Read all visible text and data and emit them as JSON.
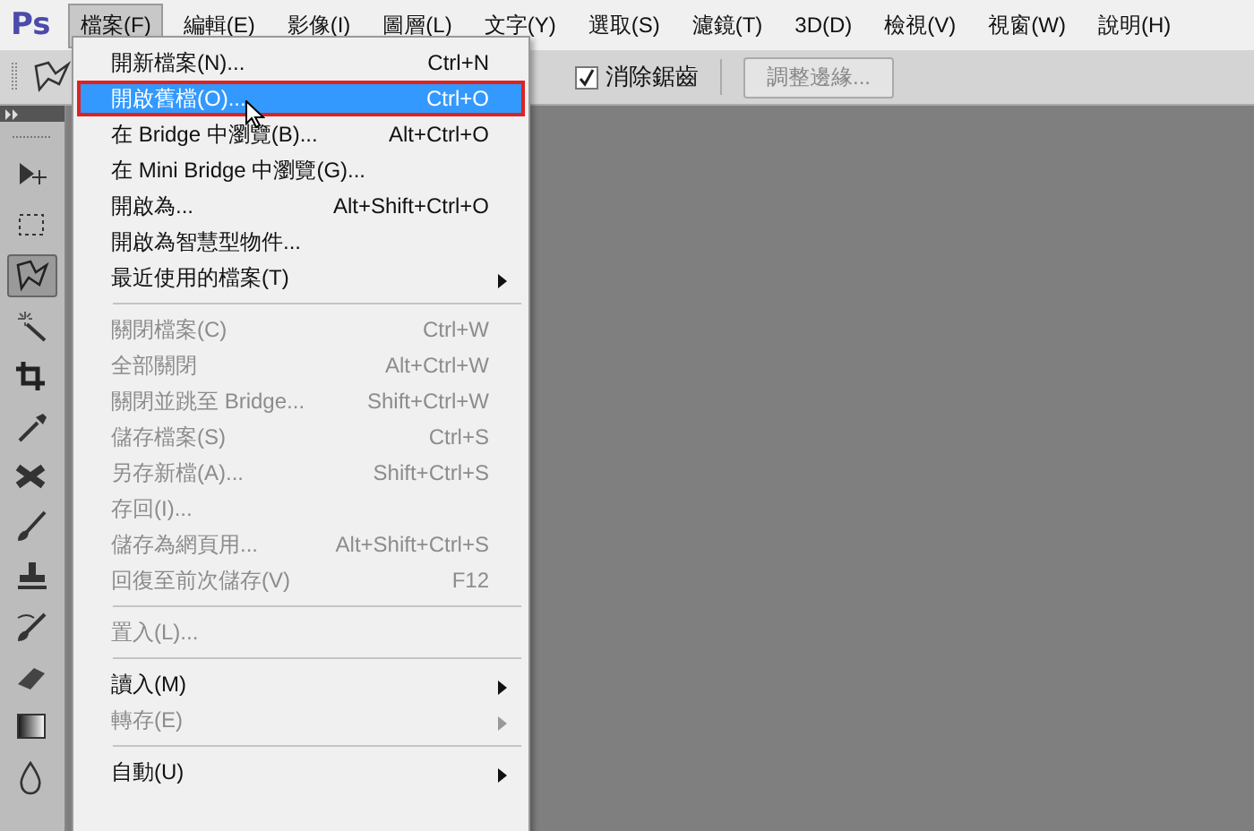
{
  "app": {
    "logo": "Ps"
  },
  "menubar": [
    {
      "label": "檔案(F)",
      "selected": true
    },
    {
      "label": "編輯(E)",
      "selected": false
    },
    {
      "label": "影像(I)",
      "selected": false
    },
    {
      "label": "圖層(L)",
      "selected": false
    },
    {
      "label": "文字(Y)",
      "selected": false
    },
    {
      "label": "選取(S)",
      "selected": false
    },
    {
      "label": "濾鏡(T)",
      "selected": false
    },
    {
      "label": "3D(D)",
      "selected": false
    },
    {
      "label": "檢視(V)",
      "selected": false
    },
    {
      "label": "視窗(W)",
      "selected": false
    },
    {
      "label": "說明(H)",
      "selected": false
    }
  ],
  "options_bar": {
    "antialias": {
      "label": "消除鋸齒",
      "checked": true
    },
    "refine_button": {
      "label": "調整邊緣...",
      "disabled": true
    }
  },
  "tools": [
    {
      "kind": "move",
      "selected": false
    },
    {
      "kind": "marquee",
      "selected": false
    },
    {
      "kind": "lasso",
      "selected": true
    },
    {
      "kind": "wand",
      "selected": false
    },
    {
      "kind": "crop",
      "selected": false
    },
    {
      "kind": "eyedropper",
      "selected": false
    },
    {
      "kind": "healing",
      "selected": false
    },
    {
      "kind": "brush",
      "selected": false
    },
    {
      "kind": "stamp",
      "selected": false
    },
    {
      "kind": "history",
      "selected": false
    },
    {
      "kind": "eraser",
      "selected": false
    },
    {
      "kind": "gradient",
      "selected": false
    },
    {
      "kind": "blur",
      "selected": false
    }
  ],
  "file_menu": [
    {
      "kind": "item",
      "label": "開新檔案(N)...",
      "shortcut": "Ctrl+N",
      "disabled": false,
      "selected": false
    },
    {
      "kind": "item",
      "label": "開啟舊檔(O)...",
      "shortcut": "Ctrl+O",
      "disabled": false,
      "selected": true
    },
    {
      "kind": "item",
      "label": "在 Bridge 中瀏覽(B)...",
      "shortcut": "Alt+Ctrl+O",
      "disabled": false,
      "selected": false
    },
    {
      "kind": "item",
      "label": "在 Mini Bridge 中瀏覽(G)...",
      "disabled": false,
      "selected": false
    },
    {
      "kind": "item",
      "label": "開啟為...",
      "shortcut": "Alt+Shift+Ctrl+O",
      "disabled": false,
      "selected": false
    },
    {
      "kind": "item",
      "label": "開啟為智慧型物件...",
      "disabled": false,
      "selected": false
    },
    {
      "kind": "submenu",
      "label": "最近使用的檔案(T)",
      "disabled": false,
      "selected": false
    },
    {
      "kind": "separator"
    },
    {
      "kind": "item",
      "label": "關閉檔案(C)",
      "shortcut": "Ctrl+W",
      "disabled": true,
      "selected": false
    },
    {
      "kind": "item",
      "label": "全部關閉",
      "shortcut": "Alt+Ctrl+W",
      "disabled": true,
      "selected": false
    },
    {
      "kind": "item",
      "label": "關閉並跳至 Bridge...",
      "shortcut": "Shift+Ctrl+W",
      "disabled": true,
      "selected": false
    },
    {
      "kind": "item",
      "label": "儲存檔案(S)",
      "shortcut": "Ctrl+S",
      "disabled": true,
      "selected": false
    },
    {
      "kind": "item",
      "label": "另存新檔(A)...",
      "shortcut": "Shift+Ctrl+S",
      "disabled": true,
      "selected": false
    },
    {
      "kind": "item",
      "label": "存回(I)...",
      "disabled": true,
      "selected": false
    },
    {
      "kind": "item",
      "label": "儲存為網頁用...",
      "shortcut": "Alt+Shift+Ctrl+S",
      "disabled": true,
      "selected": false
    },
    {
      "kind": "item",
      "label": "回復至前次儲存(V)",
      "shortcut": "F12",
      "disabled": true,
      "selected": false
    },
    {
      "kind": "separator"
    },
    {
      "kind": "item",
      "label": "置入(L)...",
      "disabled": true,
      "selected": false
    },
    {
      "kind": "separator"
    },
    {
      "kind": "submenu",
      "label": "讀入(M)",
      "disabled": false,
      "selected": false
    },
    {
      "kind": "submenu",
      "label": "轉存(E)",
      "disabled": true,
      "selected": false
    },
    {
      "kind": "separator"
    },
    {
      "kind": "submenu",
      "label": "自動(U)",
      "disabled": false,
      "selected": false
    }
  ]
}
